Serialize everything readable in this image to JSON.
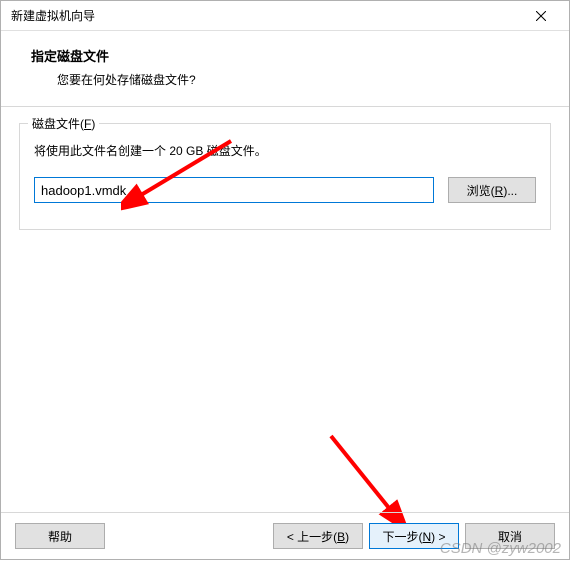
{
  "titlebar": {
    "title": "新建虚拟机向导"
  },
  "header": {
    "title": "指定磁盘文件",
    "subtitle": "您要在何处存储磁盘文件?"
  },
  "group": {
    "legend_prefix": "磁盘文件(",
    "legend_accel": "F",
    "legend_suffix": ")",
    "description": "将使用此文件名创建一个 20 GB 磁盘文件。",
    "file_value": "hadoop1.vmdk",
    "browse_prefix": "浏览(",
    "browse_accel": "R",
    "browse_suffix": ")..."
  },
  "footer": {
    "help": "帮助",
    "back_prefix": "< 上一步(",
    "back_accel": "B",
    "back_suffix": ")",
    "next_prefix": "下一步(",
    "next_accel": "N",
    "next_suffix": ") >",
    "cancel": "取消"
  },
  "watermark": "CSDN @zyw2002"
}
